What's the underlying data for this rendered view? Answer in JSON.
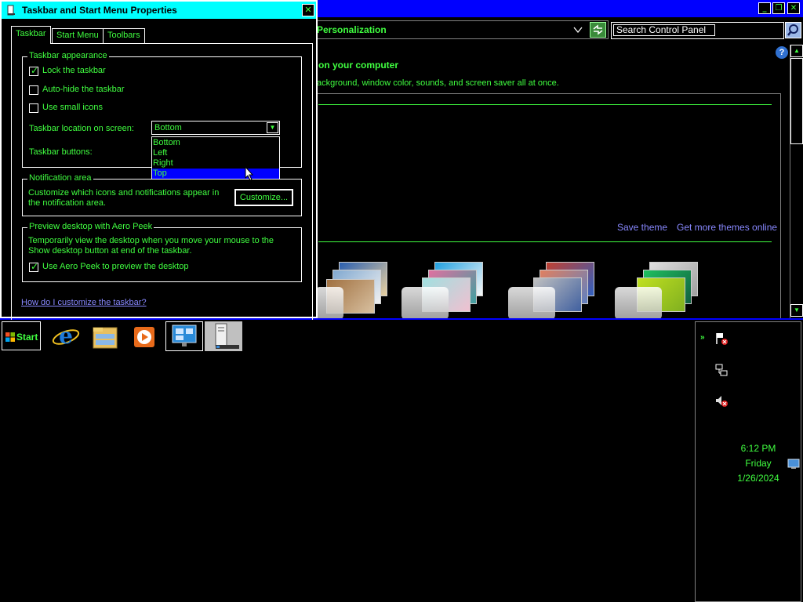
{
  "colors": {
    "text": "#40ff40",
    "title_bar_active": "#00ffff",
    "title_bar_background_window": "#0000ff",
    "link": "#8888ff",
    "selection": "#0000ff"
  },
  "control_panel": {
    "address": "Personalization",
    "search_placeholder": "Search Control Panel",
    "help_icon": "?",
    "heading": "on your computer",
    "description": "ackground, window color, sounds, and screen saver all at once.",
    "save_theme": "Save theme",
    "more_themes": "Get more themes online",
    "window_buttons": {
      "minimize": "_",
      "maximize": "❐",
      "close": "✕"
    }
  },
  "dialog": {
    "title": "Taskbar and Start Menu Properties",
    "close": "✕",
    "tabs": [
      "Taskbar",
      "Start Menu",
      "Toolbars"
    ],
    "appearance": {
      "legend": "Taskbar appearance",
      "lock_taskbar": {
        "label": "Lock the taskbar",
        "checked": true
      },
      "auto_hide": {
        "label": "Auto-hide the taskbar",
        "checked": false
      },
      "small_icons": {
        "label": "Use small icons",
        "checked": false
      },
      "location_label": "Taskbar location on screen:",
      "location_value": "Bottom",
      "location_options": [
        "Bottom",
        "Left",
        "Right",
        "Top"
      ],
      "location_highlighted": "Top",
      "buttons_label": "Taskbar buttons:"
    },
    "notification": {
      "legend": "Notification area",
      "text": "Customize which icons and notifications appear in the notification area.",
      "button": "Customize..."
    },
    "aero_peek": {
      "legend": "Preview desktop with Aero Peek",
      "text": "Temporarily view the desktop when you move your mouse to the Show desktop button at end of the taskbar.",
      "checkbox": {
        "label": "Use Aero Peek to preview the desktop",
        "checked": true
      }
    },
    "help_link": "How do I customize the taskbar?"
  },
  "taskbar": {
    "start_label": "Start",
    "apps": [
      "internet-explorer-icon",
      "file-explorer-icon",
      "media-player-icon",
      "control-panel-icon",
      "taskbar-properties-icon"
    ],
    "tray": {
      "chevron": "»",
      "time": "6:12 PM",
      "day": "Friday",
      "date": "1/26/2024"
    }
  }
}
